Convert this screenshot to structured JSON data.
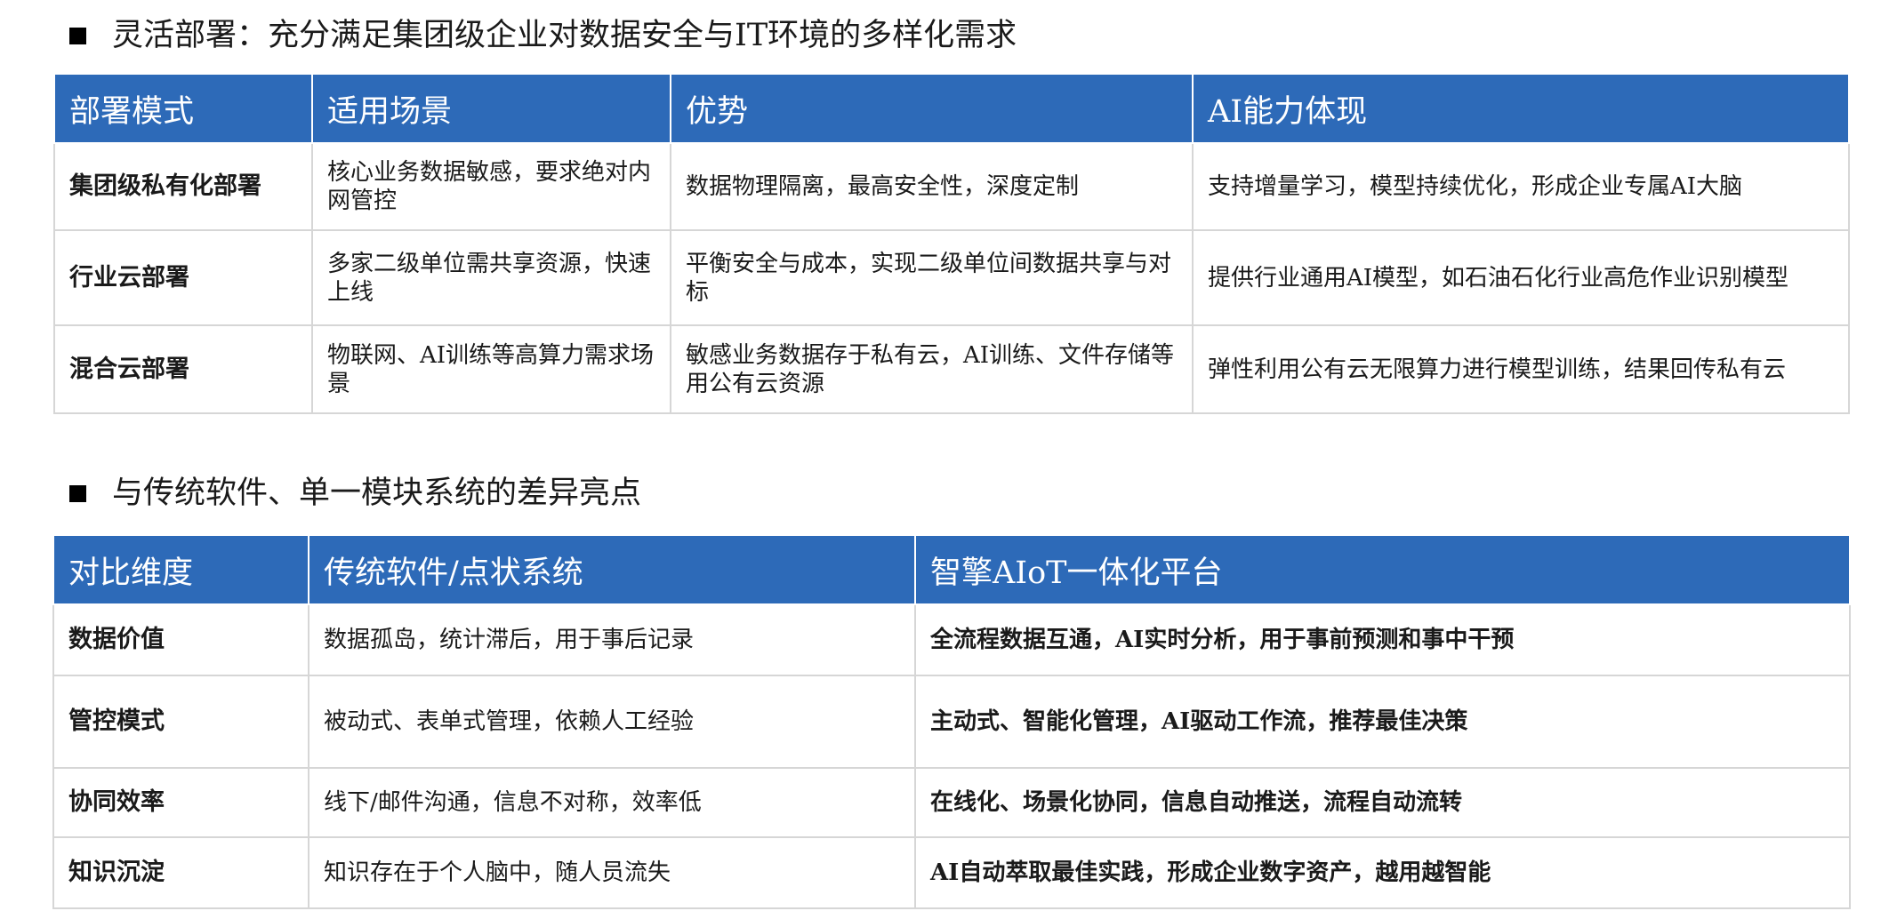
{
  "section1": {
    "heading": "灵活部署：充分满足集团级企业对数据安全与IT环境的多样化需求",
    "headers": [
      "部署模式",
      "适用场景",
      "优势",
      "AI能力体现"
    ],
    "rows": [
      [
        "集团级私有化部署",
        "核心业务数据敏感，要求绝对内网管控",
        "数据物理隔离，最高安全性，深度定制",
        "支持增量学习，模型持续优化，形成企业专属AI大脑"
      ],
      [
        "行业云部署",
        "多家二级单位需共享资源，快速上线",
        "平衡安全与成本，实现二级单位间数据共享与对标",
        "提供行业通用AI模型，如石油石化行业高危作业识别模型"
      ],
      [
        "混合云部署",
        "物联网、AI训练等高算力需求场景",
        "敏感业务数据存于私有云，AI训练、文件存储等用公有云资源",
        "弹性利用公有云无限算力进行模型训练，结果回传私有云"
      ]
    ]
  },
  "section2": {
    "heading": "与传统软件、单一模块系统的差异亮点",
    "headers": [
      "对比维度",
      "传统软件/点状系统",
      "智擎AIoT一体化平台"
    ],
    "rows": [
      [
        "数据价值",
        "数据孤岛，统计滞后，用于事后记录",
        "全流程数据互通，AI实时分析，用于事前预测和事中干预"
      ],
      [
        "管控模式",
        "被动式、表单式管理，依赖人工经验",
        "主动式、智能化管理，AI驱动工作流，推荐最佳决策"
      ],
      [
        "协同效率",
        "线下/邮件沟通，信息不对称，效率低",
        "在线化、场景化协同，信息自动推送，流程自动流转"
      ],
      [
        "知识沉淀",
        "知识存在于个人脑中，随人员流失",
        "AI自动萃取最佳实践，形成企业数字资产，越用越智能"
      ]
    ]
  },
  "colors": {
    "header_bg": "#2d6ab8",
    "header_text": "#ffffff",
    "border": "#d6d6d6",
    "bullet": "#000000"
  }
}
